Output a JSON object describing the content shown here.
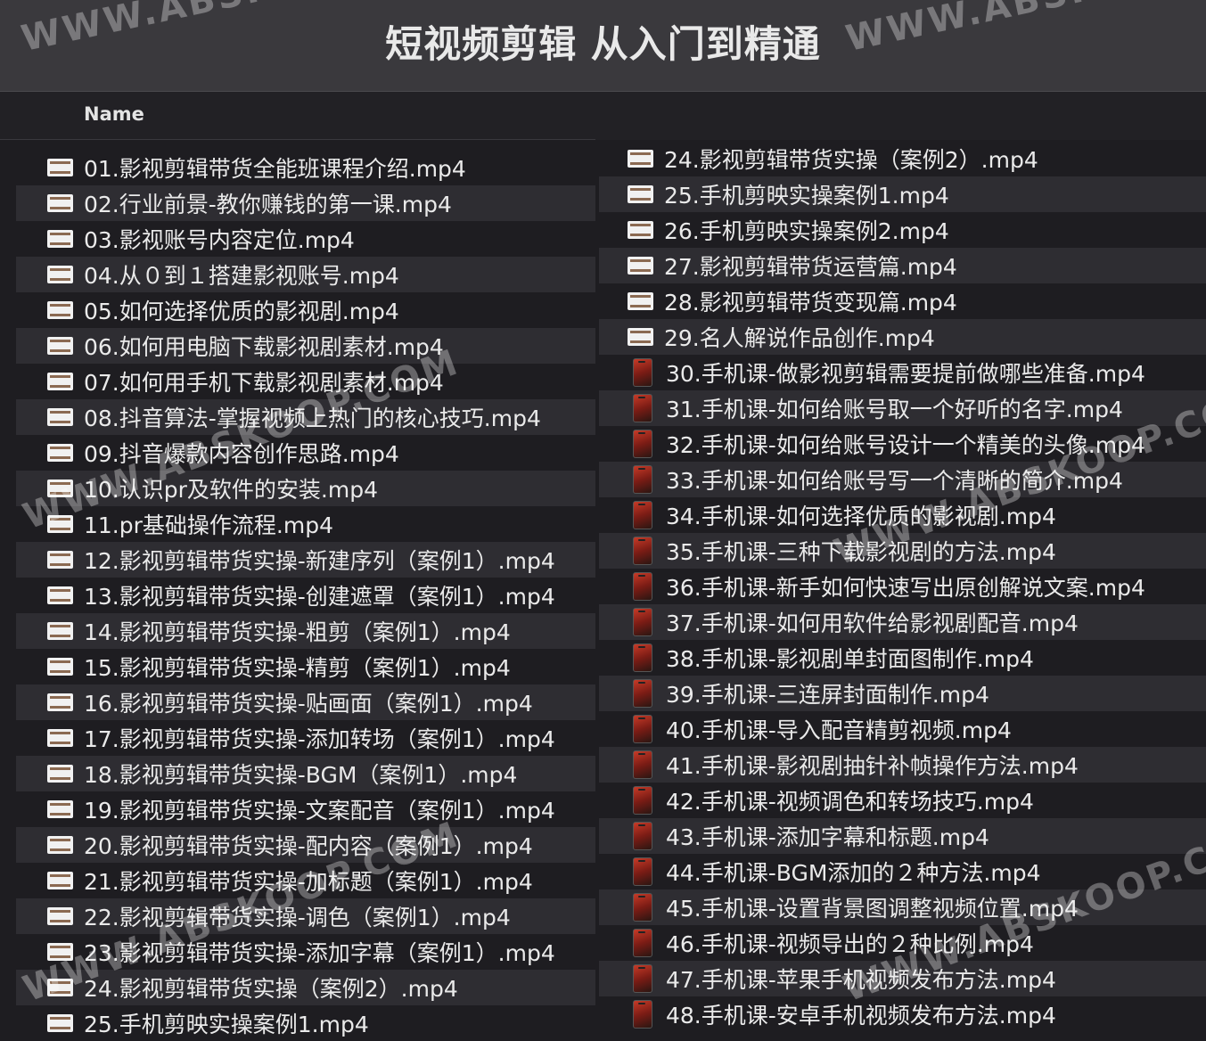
{
  "window": {
    "title": "短视频剪辑 从入门到精通",
    "column_header": "Name"
  },
  "colors": {
    "background": "#1e1d21",
    "titlebar": "#3a393d",
    "alternate_row": "#2e2d32",
    "text": "#eaeaea"
  },
  "watermark": "WWW.ABSKOOP.COM",
  "left_files": [
    {
      "name": "01.影视剪辑带货全能班课程介绍.mp4",
      "icon": "video-thumbnail-icon"
    },
    {
      "name": "02.行业前景-教你赚钱的第一课.mp4",
      "icon": "video-thumbnail-icon"
    },
    {
      "name": "03.影视账号内容定位.mp4",
      "icon": "video-thumbnail-icon"
    },
    {
      "name": "04.从０到１搭建影视账号.mp4",
      "icon": "video-thumbnail-icon"
    },
    {
      "name": "05.如何选择优质的影视剧.mp4",
      "icon": "video-thumbnail-icon"
    },
    {
      "name": "06.如何用电脑下载影视剧素材.mp4",
      "icon": "video-thumbnail-icon"
    },
    {
      "name": "07.如何用手机下载影视剧素材.mp4",
      "icon": "video-thumbnail-icon"
    },
    {
      "name": "08.抖音算法-掌握视频上热门的核心技巧.mp4",
      "icon": "video-thumbnail-icon"
    },
    {
      "name": "09.抖音爆款内容创作思路.mp4",
      "icon": "video-thumbnail-icon"
    },
    {
      "name": "10.认识pr及软件的安装.mp4",
      "icon": "video-thumbnail-icon"
    },
    {
      "name": "11.pr基础操作流程.mp4",
      "icon": "video-thumbnail-icon"
    },
    {
      "name": "12.影视剪辑带货实操-新建序列（案例1）.mp4",
      "icon": "video-thumbnail-icon"
    },
    {
      "name": "13.影视剪辑带货实操-创建遮罩（案例1）.mp4",
      "icon": "video-thumbnail-icon"
    },
    {
      "name": "14.影视剪辑带货实操-粗剪（案例1）.mp4",
      "icon": "video-thumbnail-icon"
    },
    {
      "name": "15.影视剪辑带货实操-精剪（案例1）.mp4",
      "icon": "video-thumbnail-icon"
    },
    {
      "name": "16.影视剪辑带货实操-贴画面（案例1）.mp4",
      "icon": "video-thumbnail-icon"
    },
    {
      "name": "17.影视剪辑带货实操-添加转场（案例1）.mp4",
      "icon": "video-thumbnail-icon"
    },
    {
      "name": "18.影视剪辑带货实操-BGM（案例1）.mp4",
      "icon": "video-thumbnail-icon"
    },
    {
      "name": "19.影视剪辑带货实操-文案配音（案例1）.mp4",
      "icon": "video-thumbnail-icon"
    },
    {
      "name": "20.影视剪辑带货实操-配内容（案例1）.mp4",
      "icon": "video-thumbnail-icon"
    },
    {
      "name": "21.影视剪辑带货实操-加标题（案例1）.mp4",
      "icon": "video-thumbnail-icon"
    },
    {
      "name": "22.影视剪辑带货实操-调色（案例1）.mp4",
      "icon": "video-thumbnail-icon"
    },
    {
      "name": "23.影视剪辑带货实操-添加字幕（案例1）.mp4",
      "icon": "video-thumbnail-icon"
    },
    {
      "name": "24.影视剪辑带货实操（案例2）.mp4",
      "icon": "video-thumbnail-icon"
    },
    {
      "name": "25.手机剪映实操案例1.mp4",
      "icon": "video-thumbnail-icon"
    }
  ],
  "right_files": [
    {
      "name": "24.影视剪辑带货实操（案例2）.mp4",
      "icon": "video-thumbnail-icon"
    },
    {
      "name": "25.手机剪映实操案例1.mp4",
      "icon": "video-thumbnail-icon"
    },
    {
      "name": "26.手机剪映实操案例2.mp4",
      "icon": "video-thumbnail-icon"
    },
    {
      "name": "27.影视剪辑带货运营篇.mp4",
      "icon": "video-thumbnail-icon"
    },
    {
      "name": "28.影视剪辑带货变现篇.mp4",
      "icon": "video-thumbnail-icon"
    },
    {
      "name": "29.名人解说作品创作.mp4",
      "icon": "video-thumbnail-icon"
    },
    {
      "name": "30.手机课-做影视剪辑需要提前做哪些准备.mp4",
      "icon": "phone-thumbnail-icon"
    },
    {
      "name": "31.手机课-如何给账号取一个好听的名字.mp4",
      "icon": "phone-thumbnail-icon"
    },
    {
      "name": "32.手机课-如何给账号设计一个精美的头像.mp4",
      "icon": "phone-thumbnail-icon"
    },
    {
      "name": "33.手机课-如何给账号写一个清晰的简介.mp4",
      "icon": "phone-thumbnail-icon"
    },
    {
      "name": "34.手机课-如何选择优质的影视剧.mp4",
      "icon": "phone-thumbnail-icon"
    },
    {
      "name": "35.手机课-三种下载影视剧的方法.mp4",
      "icon": "phone-thumbnail-icon"
    },
    {
      "name": "36.手机课-新手如何快速写出原创解说文案.mp4",
      "icon": "phone-thumbnail-icon"
    },
    {
      "name": "37.手机课-如何用软件给影视剧配音.mp4",
      "icon": "phone-thumbnail-icon"
    },
    {
      "name": "38.手机课-影视剧单封面图制作.mp4",
      "icon": "phone-thumbnail-icon"
    },
    {
      "name": "39.手机课-三连屏封面制作.mp4",
      "icon": "phone-thumbnail-icon"
    },
    {
      "name": "40.手机课-导入配音精剪视频.mp4",
      "icon": "phone-thumbnail-icon"
    },
    {
      "name": "41.手机课-影视剧抽针补帧操作方法.mp4",
      "icon": "phone-thumbnail-icon"
    },
    {
      "name": "42.手机课-视频调色和转场技巧.mp4",
      "icon": "phone-thumbnail-icon"
    },
    {
      "name": "43.手机课-添加字幕和标题.mp4",
      "icon": "phone-thumbnail-icon"
    },
    {
      "name": "44.手机课-BGM添加的２种方法.mp4",
      "icon": "phone-thumbnail-icon"
    },
    {
      "name": "45.手机课-设置背景图调整视频位置.mp4",
      "icon": "phone-thumbnail-icon"
    },
    {
      "name": "46.手机课-视频导出的２种比例.mp4",
      "icon": "phone-thumbnail-icon"
    },
    {
      "name": "47.手机课-苹果手机视频发布方法.mp4",
      "icon": "phone-thumbnail-icon"
    },
    {
      "name": "48.手机课-安卓手机视频发布方法.mp4",
      "icon": "phone-thumbnail-icon"
    }
  ]
}
